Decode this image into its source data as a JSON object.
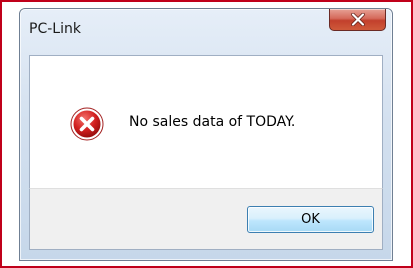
{
  "window": {
    "title": "PC-Link",
    "close_icon": "close-x-icon"
  },
  "dialog": {
    "icon": "error-icon",
    "message": "No sales data of TODAY."
  },
  "buttons": {
    "ok_label": "OK"
  },
  "colors": {
    "outer_frame": "#c0001a",
    "close_button": "#c2402c",
    "error_icon": "#d21f1f",
    "ok_button_border": "#3c7fb1"
  }
}
